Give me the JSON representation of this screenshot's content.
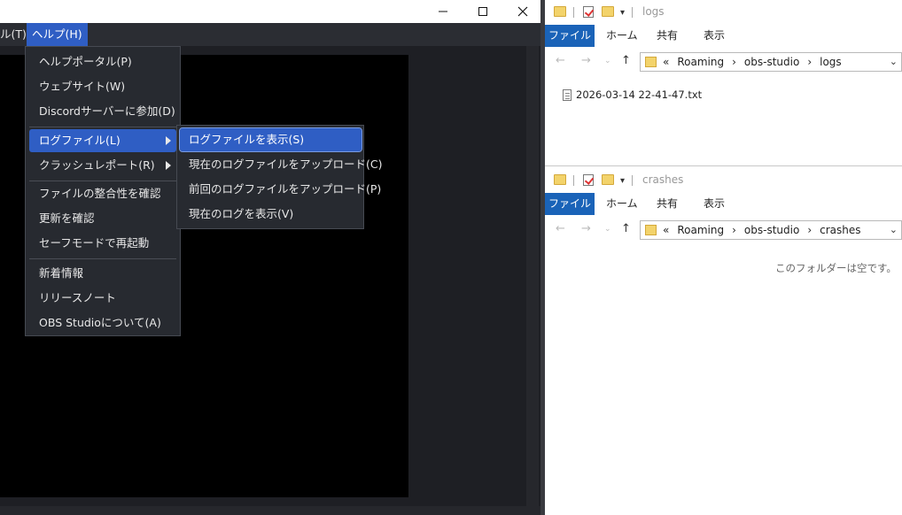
{
  "obs": {
    "menubar": {
      "tools_label": "ル(T)",
      "help_label": "ヘルプ(H)"
    },
    "help_menu": {
      "items": [
        "ヘルプポータル(P)",
        "ウェブサイト(W)",
        "Discordサーバーに参加(D)",
        "ログファイル(L)",
        "クラッシュレポート(R)",
        "ファイルの整合性を確認",
        "更新を確認",
        "セーフモードで再起動",
        "新着情報",
        "リリースノート",
        "OBS Studioについて(A)"
      ]
    },
    "log_submenu": {
      "items": [
        "ログファイルを表示(S)",
        "現在のログファイルをアップロード(C)",
        "前回のログファイルをアップロード(P)",
        "現在のログを表示(V)"
      ]
    }
  },
  "explorer_logs": {
    "title": "logs",
    "ribbon": [
      "ファイル",
      "ホーム",
      "共有",
      "表示"
    ],
    "path": [
      "«",
      "Roaming",
      "›",
      "obs-studio",
      "›",
      "logs"
    ],
    "files": [
      "2026-03-14 22-41-47.txt"
    ]
  },
  "explorer_crashes": {
    "title": "crashes",
    "ribbon": [
      "ファイル",
      "ホーム",
      "共有",
      "表示"
    ],
    "path": [
      "«",
      "Roaming",
      "›",
      "obs-studio",
      "›",
      "crashes"
    ],
    "empty_message": "このフォルダーは空です。"
  },
  "colors": {
    "accent": "#2f5ec4",
    "menu_bg": "#272a30",
    "explorer_file_tab": "#1a63b8"
  }
}
